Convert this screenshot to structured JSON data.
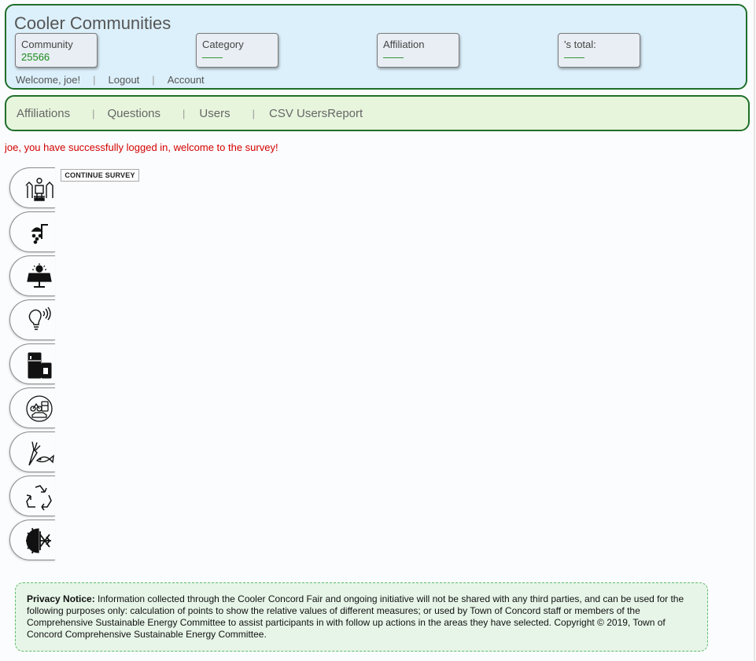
{
  "header": {
    "title": "Cooler Communities",
    "stats": [
      {
        "label": "Community",
        "value": "25566"
      },
      {
        "label": "Category",
        "value": "——"
      },
      {
        "label": "Affiliation",
        "value": "——"
      },
      {
        "label": "'s total:",
        "value": "——"
      }
    ],
    "welcome": "Welcome, joe!",
    "logout": "Logout",
    "account": "Account",
    "separator": "|"
  },
  "nav": {
    "items": [
      "Affiliations",
      "Questions",
      "Users",
      "CSV UsersReport"
    ],
    "separator": "|"
  },
  "message": "joe, you have successfully logged in, welcome to the survey!",
  "continue_button": "CONTINUE SURVEY",
  "category_tabs": [
    {
      "icon": "home-energy-icon"
    },
    {
      "icon": "shower-icon"
    },
    {
      "icon": "solar-panel-icon"
    },
    {
      "icon": "smart-lightbulb-icon"
    },
    {
      "icon": "appliances-icon"
    },
    {
      "icon": "transportation-icon"
    },
    {
      "icon": "food-icon"
    },
    {
      "icon": "recycle-icon"
    },
    {
      "icon": "heating-cooling-icon"
    }
  ],
  "privacy": {
    "heading": "Privacy Notice:",
    "text": " Information collected through the Cooler Concord Fair and ongoing initiative will not be shared with any third parties, and can be used for the following purposes only: calculation of points to show the relative values of different measures; or used by Town of Concord staff or members of the Comprehensive Sustainable Energy Committee to assist participants in with follow up actions in the areas they have selected. Copyright © 2019, Town of Concord Comprehensive Sustainable Energy Committee."
  }
}
